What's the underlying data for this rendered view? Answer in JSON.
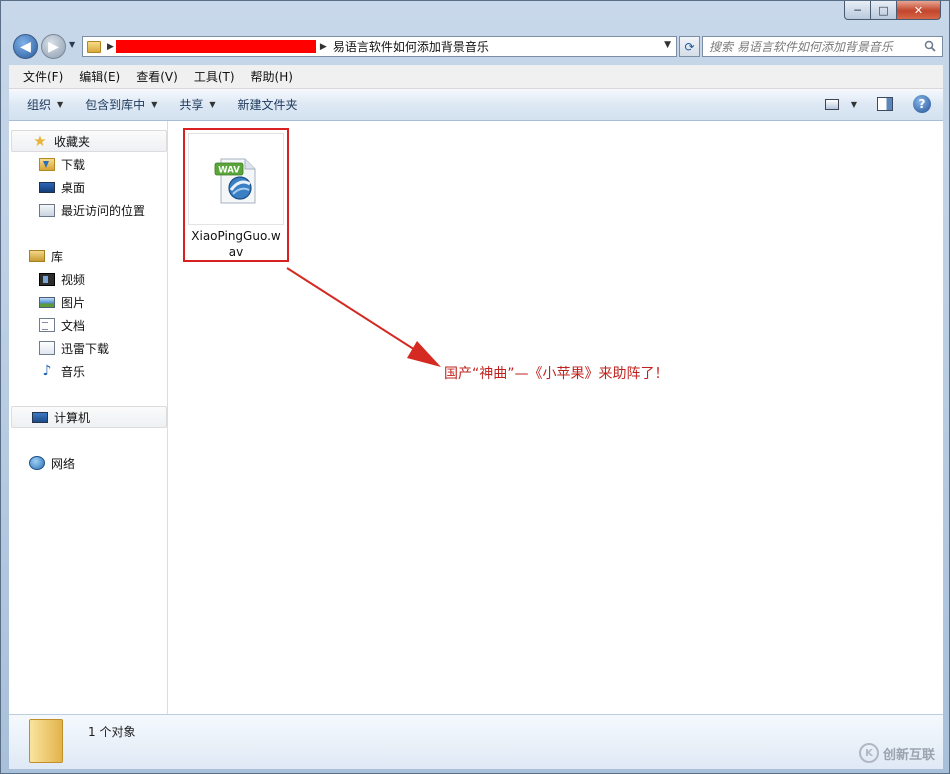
{
  "window": {
    "minimize_label": "─",
    "maximize_label": "□",
    "close_label": "✕"
  },
  "address": {
    "folder_name": "易语言软件如何添加背景音乐"
  },
  "search": {
    "placeholder": "搜索 易语言软件如何添加背景音乐"
  },
  "menu": {
    "items": [
      {
        "label": "文件(F)"
      },
      {
        "label": "编辑(E)"
      },
      {
        "label": "查看(V)"
      },
      {
        "label": "工具(T)"
      },
      {
        "label": "帮助(H)"
      }
    ]
  },
  "toolbar": {
    "organize": "组织",
    "include_library": "包含到库中",
    "share": "共享",
    "new_folder": "新建文件夹",
    "help_label": "?"
  },
  "nav": {
    "favorites": "收藏夹",
    "favorites_items": [
      {
        "label": "下载"
      },
      {
        "label": "桌面"
      },
      {
        "label": "最近访问的位置"
      }
    ],
    "libraries": "库",
    "library_items": [
      {
        "label": "视频"
      },
      {
        "label": "图片"
      },
      {
        "label": "文档"
      },
      {
        "label": "迅雷下载"
      },
      {
        "label": "音乐"
      }
    ],
    "computer": "计算机",
    "network": "网络"
  },
  "files": [
    {
      "name": "XiaoPingGuo.wav",
      "badge": "WAV"
    }
  ],
  "annotation": {
    "text": "国产“神曲”—《小苹果》来助阵了！"
  },
  "details": {
    "count_text": "1 个对象"
  },
  "watermark": {
    "text": "创新互联",
    "logo_glyph": "K"
  },
  "colors": {
    "highlight_border": "#d92020",
    "annotation": "#c0231f"
  }
}
